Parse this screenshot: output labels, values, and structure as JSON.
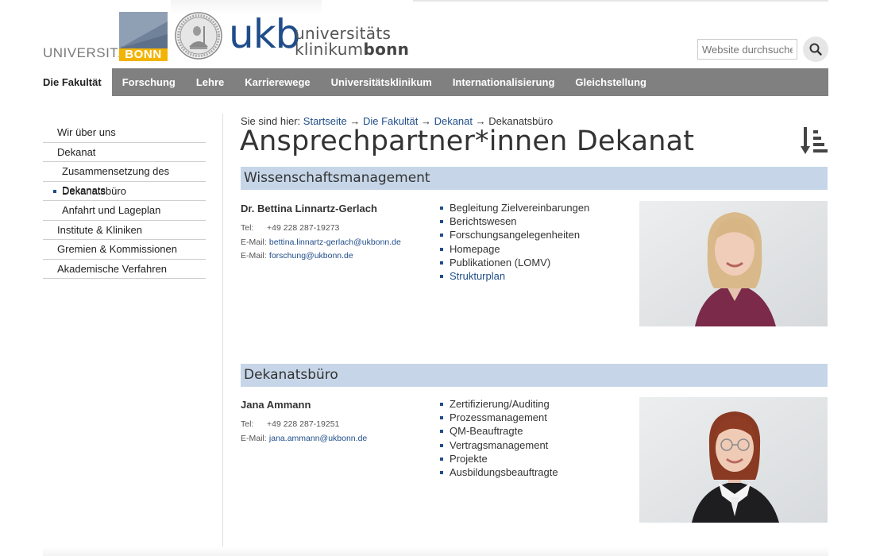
{
  "header": {
    "university_word": "UNIVERSITÄT",
    "university_bonn": "BONN",
    "ukb_logo": "ukb",
    "ukb_line1": "universitäts",
    "ukb_line2_a": "klinikum",
    "ukb_line2_b": "bonn",
    "search_placeholder": "Website durchsuchen",
    "search_icon": "magnifier-icon"
  },
  "nav": {
    "items": [
      {
        "label": "Die Fakultät",
        "active": true
      },
      {
        "label": "Forschung"
      },
      {
        "label": "Lehre"
      },
      {
        "label": "Karrierewege"
      },
      {
        "label": "Universitätsklinikum"
      },
      {
        "label": "Internationalisierung"
      },
      {
        "label": "Gleichstellung"
      }
    ]
  },
  "sidebar": {
    "items": [
      {
        "label": "Wir über uns"
      },
      {
        "label": "Dekanat"
      },
      {
        "label": "Zusammensetzung des Dekanats"
      },
      {
        "label": "Dekanatsbüro"
      },
      {
        "label": "Anfahrt und Lageplan"
      },
      {
        "label": "Institute & Kliniken"
      },
      {
        "label": "Gremien & Kommissionen"
      },
      {
        "label": "Akademische Verfahren"
      }
    ]
  },
  "breadcrumb": {
    "prefix": "Sie sind hier:",
    "items": [
      "Startseite",
      "Die Fakultät",
      "Dekanat"
    ],
    "separator": "→",
    "current": "Dekanatsbüro"
  },
  "page_title": "Ansprechpartner*innen Dekanat",
  "colors": {
    "nav_bg": "#808080",
    "section_bg": "#c6d6e8",
    "link": "#1f4d8a",
    "bonn_yellow": "#f2b400"
  },
  "sections": [
    {
      "heading": "Wissenschaftsmanagement",
      "person": {
        "name": "Dr. Bettina Linnartz-Gerlach",
        "tel_label": "Tel:",
        "tel": "+49 228 287-19273",
        "email_label": "E-Mail:",
        "email": "bettina.linnartz-gerlach@ukbonn.de",
        "email2_label": "E-Mail:",
        "email2": "forschung@ukbonn.de"
      },
      "tasks": [
        "Begleitung Zielvereinbarungen",
        "Berichtswesen",
        "Forschungsangelegenheiten",
        "Homepage",
        "Publikationen (LOMV)",
        "Strukturplan"
      ]
    },
    {
      "heading": "Dekanatsbüro",
      "person": {
        "name": "Jana Ammann",
        "tel_label": "Tel:",
        "tel": "+49 228 287-19251",
        "email_label": "E-Mail:",
        "email": "jana.ammann@ukbonn.de"
      },
      "tasks": [
        "Zertifizierung/Auditing",
        "Prozessmanagement",
        "QM-Beauftragte",
        "Vertragsmanagement",
        "Projekte",
        "Ausbildungsbeauftragte"
      ]
    }
  ]
}
